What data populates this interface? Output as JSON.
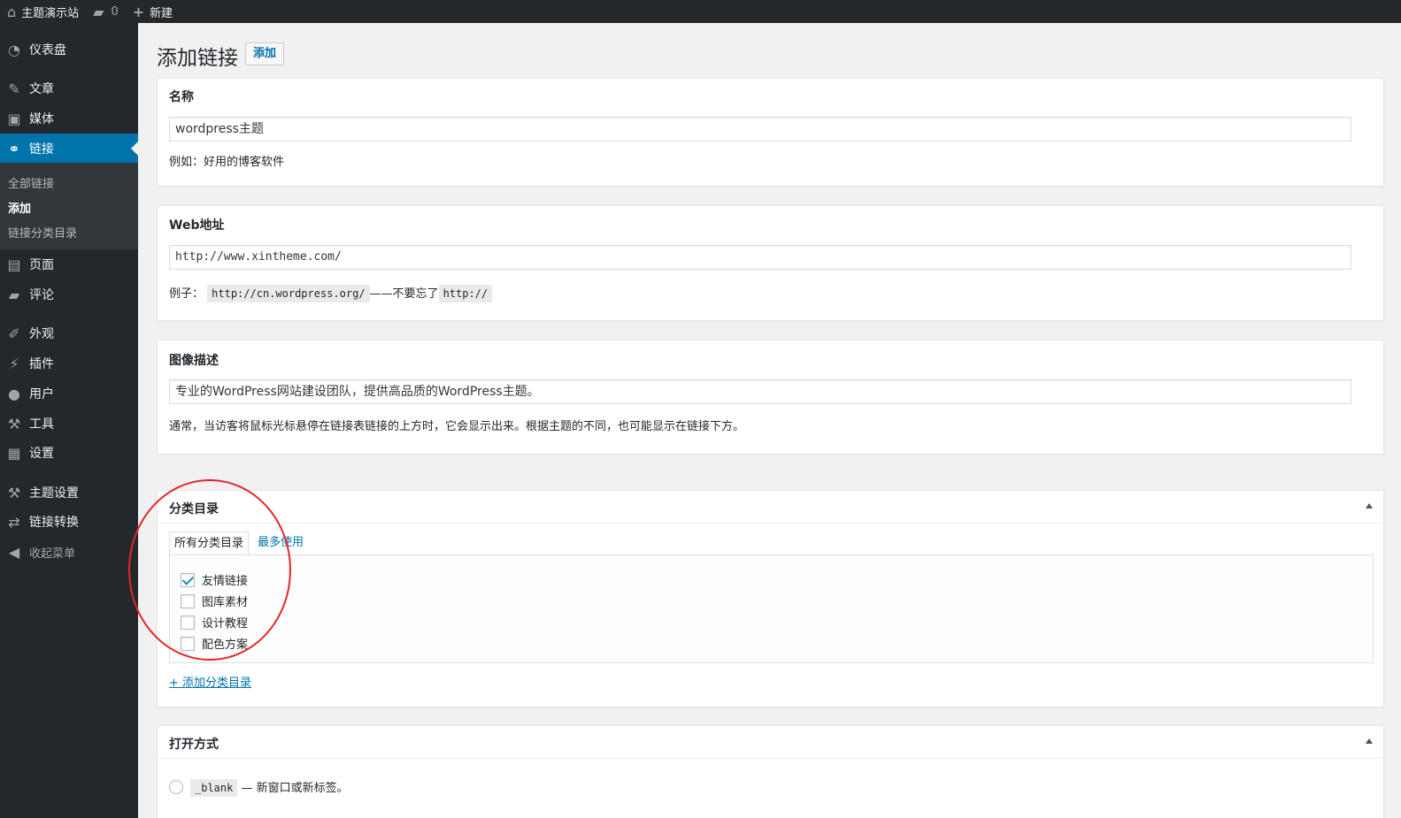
{
  "admin_bar": {
    "site_name": "主题演示站",
    "comments_count": "0",
    "new_label": "新建"
  },
  "sidebar": {
    "items": [
      {
        "label": "仪表盘",
        "icon": "dashboard-icon"
      },
      {
        "label": "文章",
        "icon": "pin-icon"
      },
      {
        "label": "媒体",
        "icon": "media-icon"
      },
      {
        "label": "链接",
        "icon": "link-icon"
      },
      {
        "label": "页面",
        "icon": "page-icon"
      },
      {
        "label": "评论",
        "icon": "comment-icon"
      },
      {
        "label": "外观",
        "icon": "appearance-icon"
      },
      {
        "label": "插件",
        "icon": "plugin-icon"
      },
      {
        "label": "用户",
        "icon": "user-icon"
      },
      {
        "label": "工具",
        "icon": "wrench-icon"
      },
      {
        "label": "设置",
        "icon": "settings-icon"
      },
      {
        "label": "主题设置",
        "icon": "hammer-icon"
      },
      {
        "label": "链接转换",
        "icon": "convert-icon"
      },
      {
        "label": "收起菜单",
        "icon": "collapse-icon"
      }
    ],
    "submenu": [
      "全部链接",
      "添加",
      "链接分类目录"
    ],
    "current_item": "链接",
    "current_sub": "添加"
  },
  "page": {
    "title": "添加链接",
    "add_button": "添加"
  },
  "name_box": {
    "label": "名称",
    "value": "wordpress主题",
    "hint": "例如：好用的博客软件"
  },
  "url_box": {
    "label": "Web地址",
    "value": "http://www.xintheme.com/",
    "hint_prefix": "例子：",
    "hint_code1": "http://cn.wordpress.org/",
    "hint_middle": "——不要忘了",
    "hint_code2": "http://"
  },
  "desc_box": {
    "label": "图像描述",
    "value": "专业的WordPress网站建设团队，提供高品质的WordPress主题。",
    "hint": "通常，当访客将鼠标光标悬停在链接表链接的上方时，它会显示出来。根据主题的不同，也可能显示在链接下方。"
  },
  "category_box": {
    "label": "分类目录",
    "tab_all": "所有分类目录",
    "tab_popular": "最多使用",
    "categories": [
      {
        "label": "友情链接",
        "checked": true
      },
      {
        "label": "图库素材",
        "checked": false
      },
      {
        "label": "设计教程",
        "checked": false
      },
      {
        "label": "配色方案",
        "checked": false
      }
    ],
    "add_link": "+ 添加分类目录"
  },
  "target_box": {
    "label": "打开方式",
    "option_code": "_blank",
    "option_desc": "— 新窗口或新标签。"
  },
  "colors": {
    "admin_dark": "#23282d",
    "accent": "#0073aa",
    "highlight": "#e3262a"
  }
}
